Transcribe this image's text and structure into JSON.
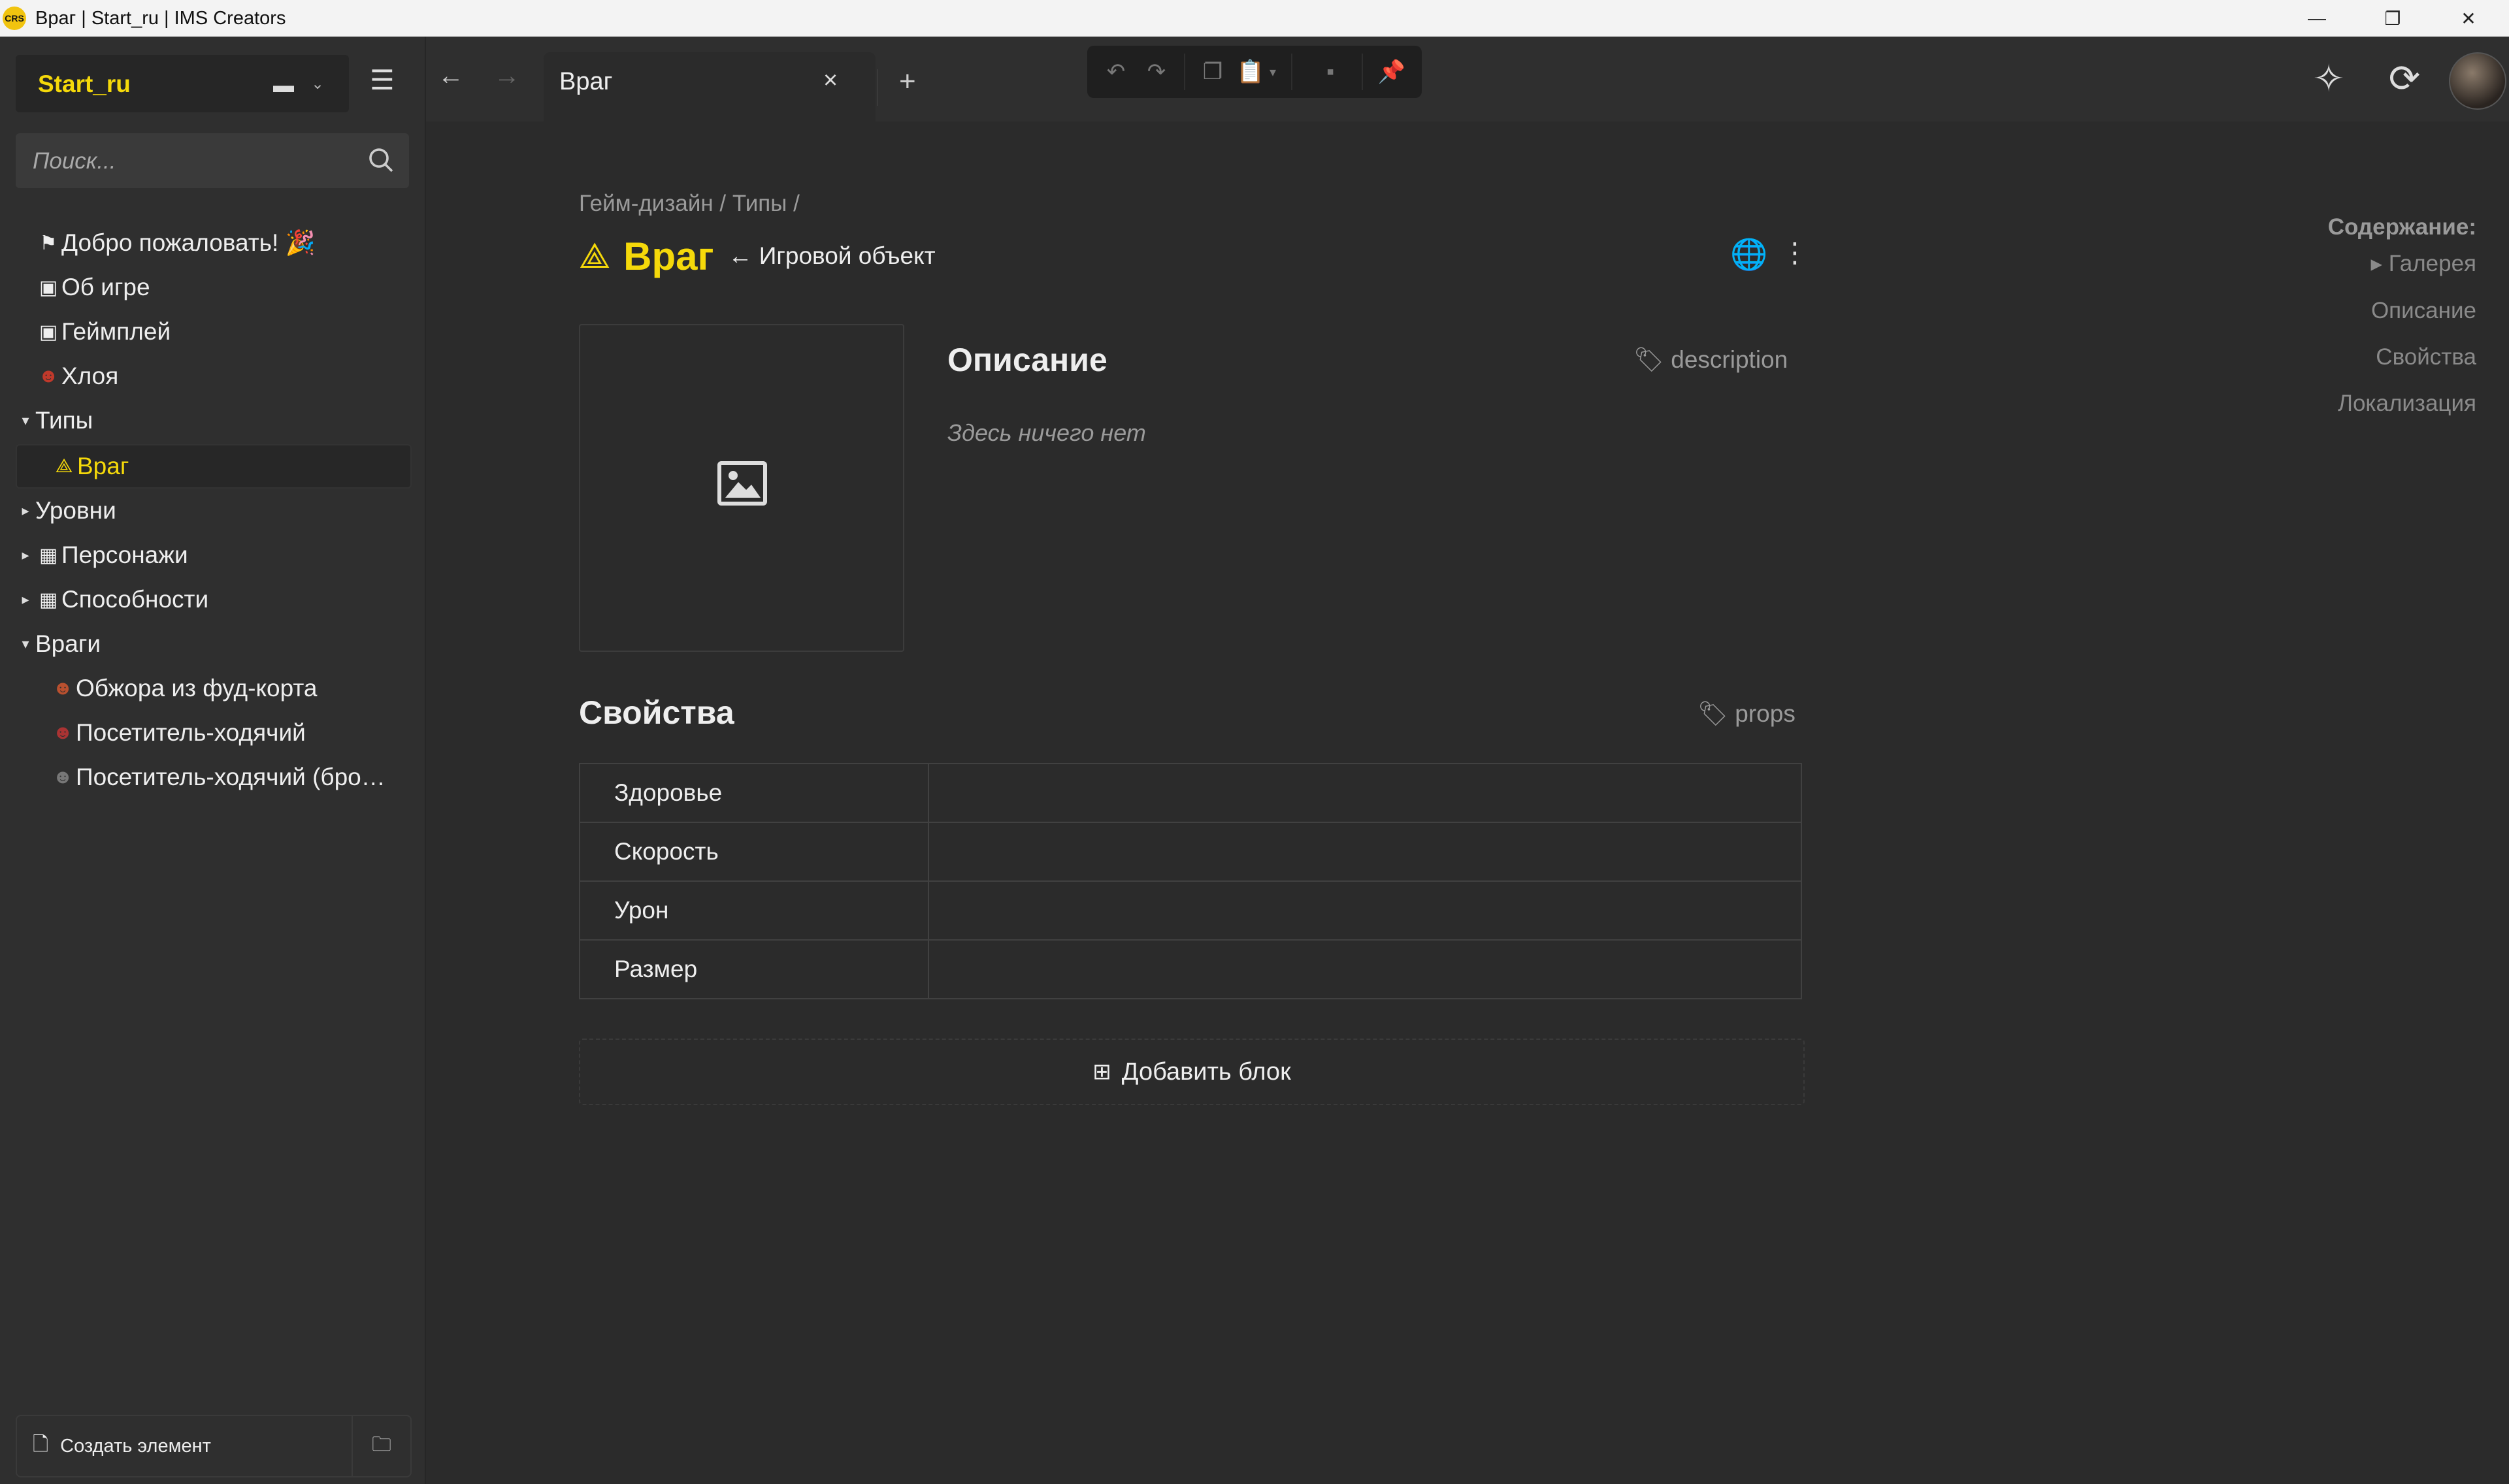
{
  "window": {
    "app_icon_text": "CRS",
    "title": "Враг | Start_ru | IMS Creators",
    "minimize": "—",
    "maximize": "❐",
    "close": "✕"
  },
  "sidebar": {
    "project_name": "Start_ru",
    "search_placeholder": "Поиск...",
    "tree": [
      {
        "label": "Добро пожаловать! 🎉",
        "icon": "⚑",
        "chevron": ""
      },
      {
        "label": "Об игре",
        "icon": "▣",
        "chevron": ""
      },
      {
        "label": "Геймплей",
        "icon": "▣",
        "chevron": ""
      },
      {
        "label": "Хлоя",
        "icon": "☻",
        "chevron": ""
      },
      {
        "label": "Типы",
        "icon": "",
        "chevron": "▾"
      },
      {
        "label": "Враг",
        "icon": "⟁",
        "chevron": ""
      },
      {
        "label": "Уровни",
        "icon": "",
        "chevron": "▸"
      },
      {
        "label": "Персонажи",
        "icon": "▦",
        "chevron": "▸"
      },
      {
        "label": "Способности",
        "icon": "▦",
        "chevron": "▸"
      },
      {
        "label": "Враги",
        "icon": "",
        "chevron": "▾"
      },
      {
        "label": "Обжора из фуд-корта",
        "icon": "☻",
        "chevron": ""
      },
      {
        "label": "Посетитель-ходячий",
        "icon": "☻",
        "chevron": ""
      },
      {
        "label": "Посетитель-ходячий (бро…",
        "icon": "☻",
        "chevron": ""
      }
    ],
    "create_label": "Создать элемент"
  },
  "tabs": {
    "active_label": "Враг",
    "new_tab": "+"
  },
  "page": {
    "breadcrumb": "Гейм-дизайн / Типы /",
    "title": "Враг",
    "parent": "← Игровой объект",
    "description": {
      "title": "Описание",
      "tag": "description",
      "empty": "Здесь ничего нет"
    },
    "props": {
      "title": "Свойства",
      "tag": "props",
      "rows": [
        {
          "key": "Здоровье",
          "value": ""
        },
        {
          "key": "Скорость",
          "value": ""
        },
        {
          "key": "Урон",
          "value": ""
        },
        {
          "key": "Размер",
          "value": ""
        }
      ]
    },
    "add_block": "Добавить блок"
  },
  "toc": {
    "heading": "Содержание:",
    "items": [
      "▸ Галерея",
      "Описание",
      "Свойства",
      "Локализация"
    ]
  },
  "colors": {
    "accent": "#f5d90a",
    "background": "#2b2b2b",
    "sidebar": "#2f2f2f"
  }
}
